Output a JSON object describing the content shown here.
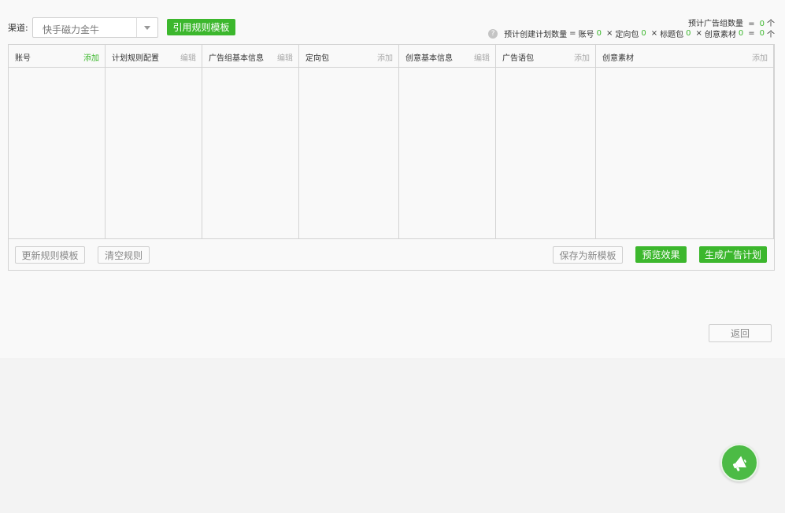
{
  "toolbar": {
    "channel_label": "渠道:",
    "channel_value": "快手磁力金牛",
    "apply_template_label": "引用规则模板"
  },
  "stats": {
    "group_label": "预计广告组数量",
    "group_value": "0",
    "unit": "个",
    "plan_label": "预计创建计划数量",
    "account_label": "账号",
    "account_value": "0",
    "targeting_label": "定向包",
    "targeting_value": "0",
    "title_label": "标题包",
    "title_value": "0",
    "material_label": "创意素材",
    "material_value": "0",
    "plan_value": "0",
    "times": "×",
    "equals": "=",
    "help": "?"
  },
  "columns": [
    {
      "title": "账号",
      "action": "添加",
      "active": true
    },
    {
      "title": "计划规则配置",
      "action": "编辑",
      "active": false
    },
    {
      "title": "广告组基本信息",
      "action": "编辑",
      "active": false
    },
    {
      "title": "定向包",
      "action": "添加",
      "active": false
    },
    {
      "title": "创意基本信息",
      "action": "编辑",
      "active": false
    },
    {
      "title": "广告语包",
      "action": "添加",
      "active": false
    },
    {
      "title": "创意素材",
      "action": "添加",
      "active": false
    }
  ],
  "footer": {
    "update_template": "更新规则模板",
    "clear_rules": "清空规则",
    "save_template": "保存为新模板",
    "preview": "预览效果",
    "generate": "生成广告计划"
  },
  "back_label": "返回",
  "colors": {
    "accent": "#3cb72d",
    "border": "#d3d3d3"
  }
}
